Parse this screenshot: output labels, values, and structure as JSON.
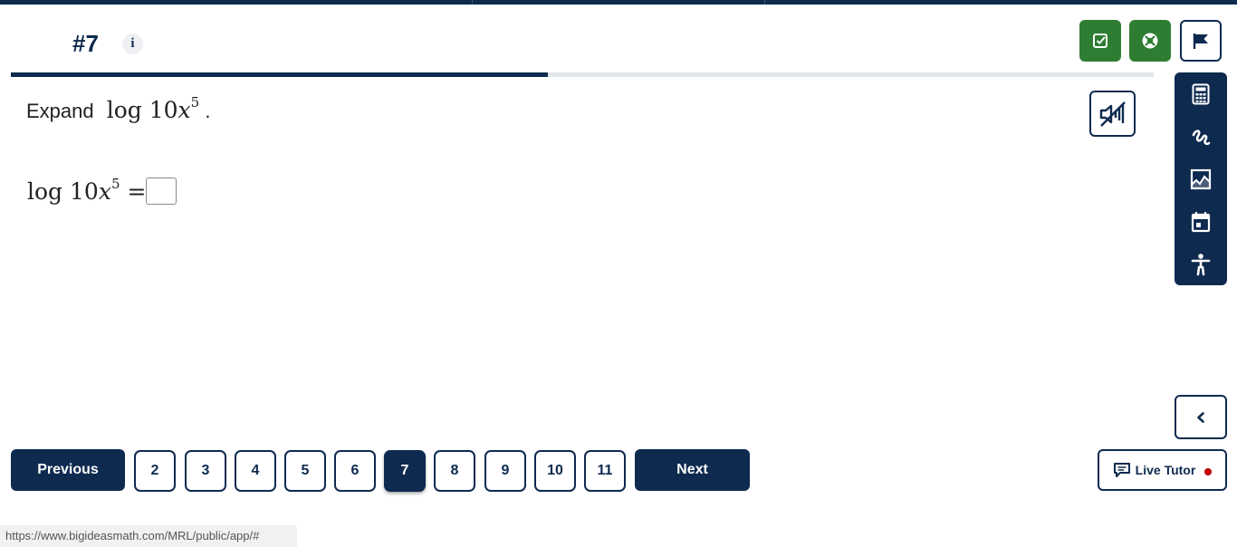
{
  "question": {
    "number": "#7",
    "info_glyph": "i",
    "progress": 0.47,
    "prompt_word": "Expand",
    "prompt_math": {
      "fn": "log",
      "coef": "10",
      "var": "x",
      "exp": "5",
      "end": "."
    },
    "equation": {
      "fn": "log",
      "coef": "10",
      "var": "x",
      "exp": "5",
      "eq": "="
    },
    "answer_value": ""
  },
  "tools": {
    "check_icon": "check-square-icon",
    "help_icon": "lifebuoy-icon",
    "flag_icon": "flag-icon",
    "audio_icon": "speaker-muted-icon",
    "sidebar": [
      "calculator-icon",
      "scribble-icon",
      "image-icon",
      "calendar-icon",
      "accessibility-icon"
    ],
    "collapse_icon": "chevron-left-icon"
  },
  "navigation": {
    "previous_label": "Previous",
    "next_label": "Next",
    "pages": [
      "2",
      "3",
      "4",
      "5",
      "6",
      "7",
      "8",
      "9",
      "10",
      "11"
    ],
    "current_page": "7"
  },
  "live_tutor": {
    "label": "Live Tutor",
    "icon": "chat-icon"
  },
  "status_bar": {
    "url": "https://www.bigideasmath.com/MRL/public/app/#"
  },
  "colors": {
    "navy": "#0e2a4f",
    "green": "#2e7d32",
    "red_dot": "#c00000"
  }
}
